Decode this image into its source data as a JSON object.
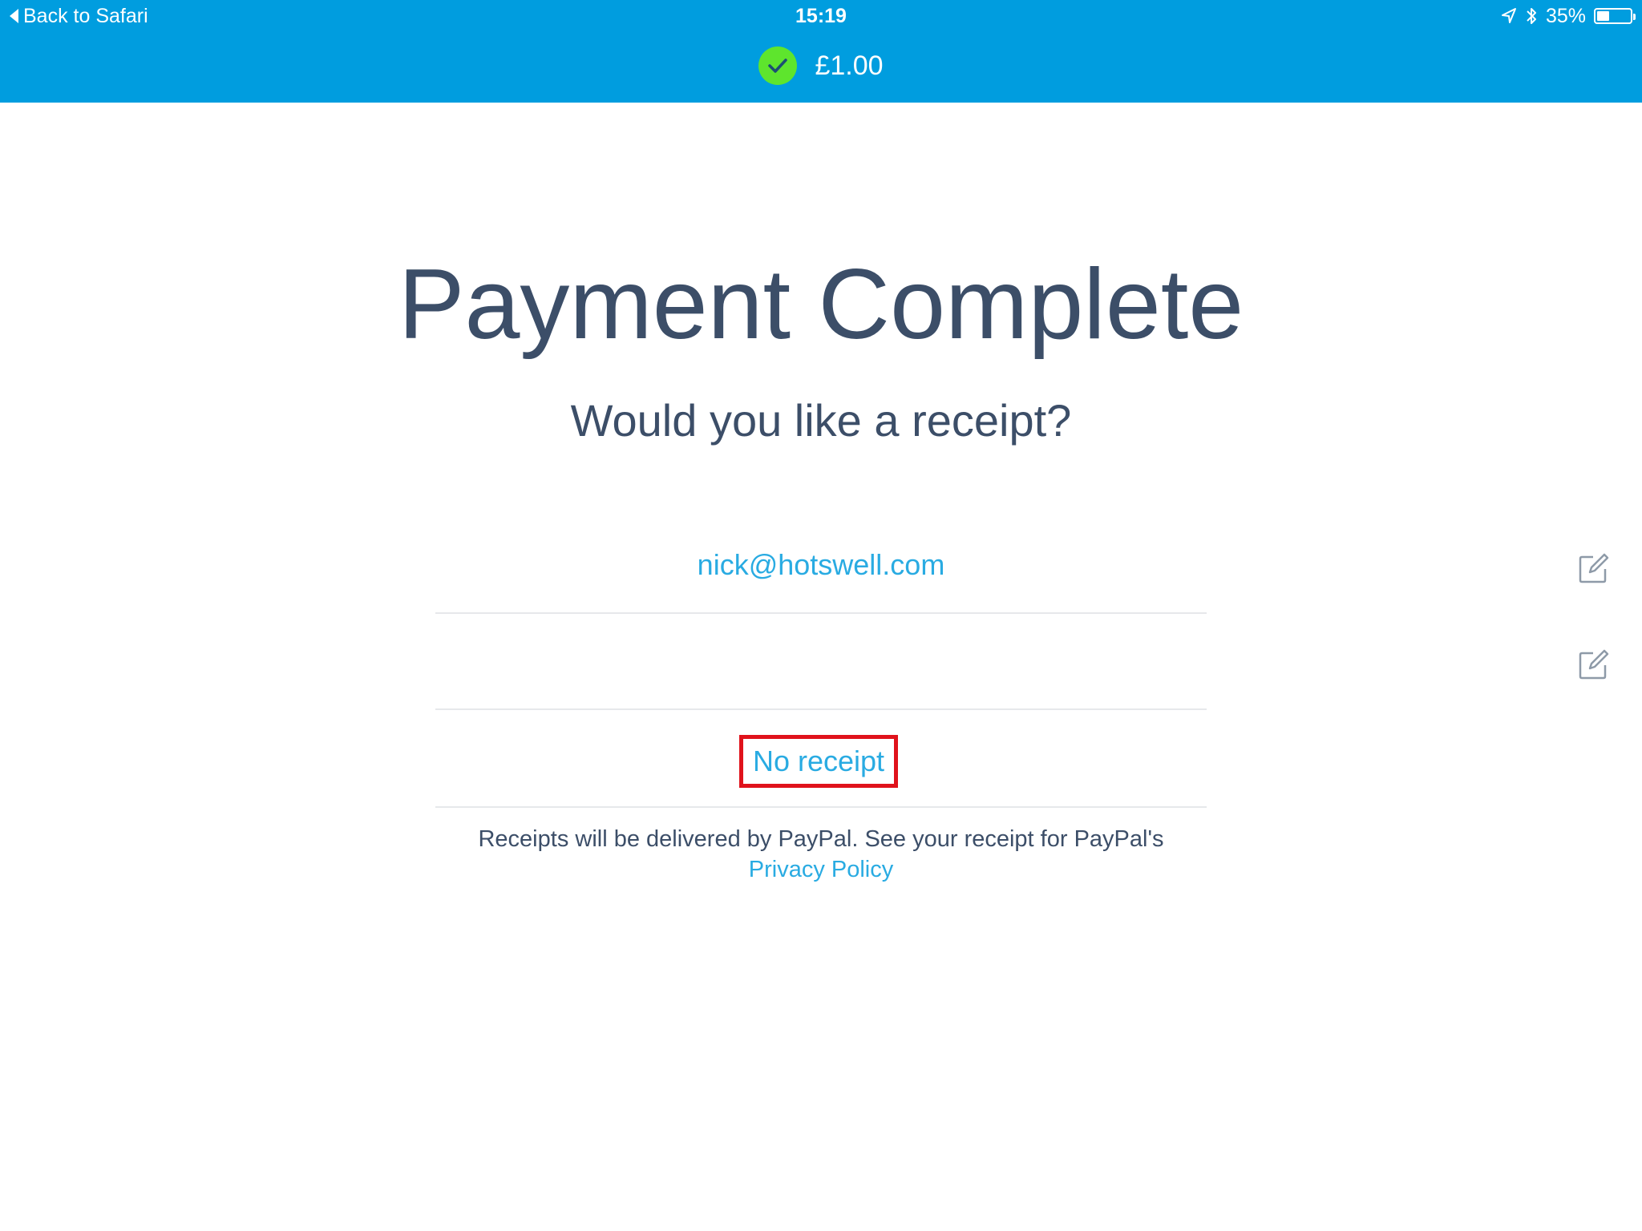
{
  "status_bar": {
    "back_label": "Back to Safari",
    "time": "15:19",
    "battery_percent": "35%"
  },
  "header": {
    "amount": "£1.00",
    "success_color": "#5ee52d",
    "bar_color": "#009ddf"
  },
  "main": {
    "title": "Payment Complete",
    "subtitle": "Would you like a receipt?",
    "email_value": "nick@hotswell.com",
    "phone_value": "",
    "no_receipt_label": "No receipt",
    "footer_text": "Receipts will be delivered by PayPal. See your receipt for PayPal's",
    "privacy_link": "Privacy Policy"
  },
  "icons": {
    "back": "chevron-left-icon",
    "location": "location-arrow-icon",
    "bluetooth": "bluetooth-icon",
    "battery": "battery-icon",
    "success": "checkmark-circle-icon",
    "edit": "edit-pencil-icon"
  }
}
